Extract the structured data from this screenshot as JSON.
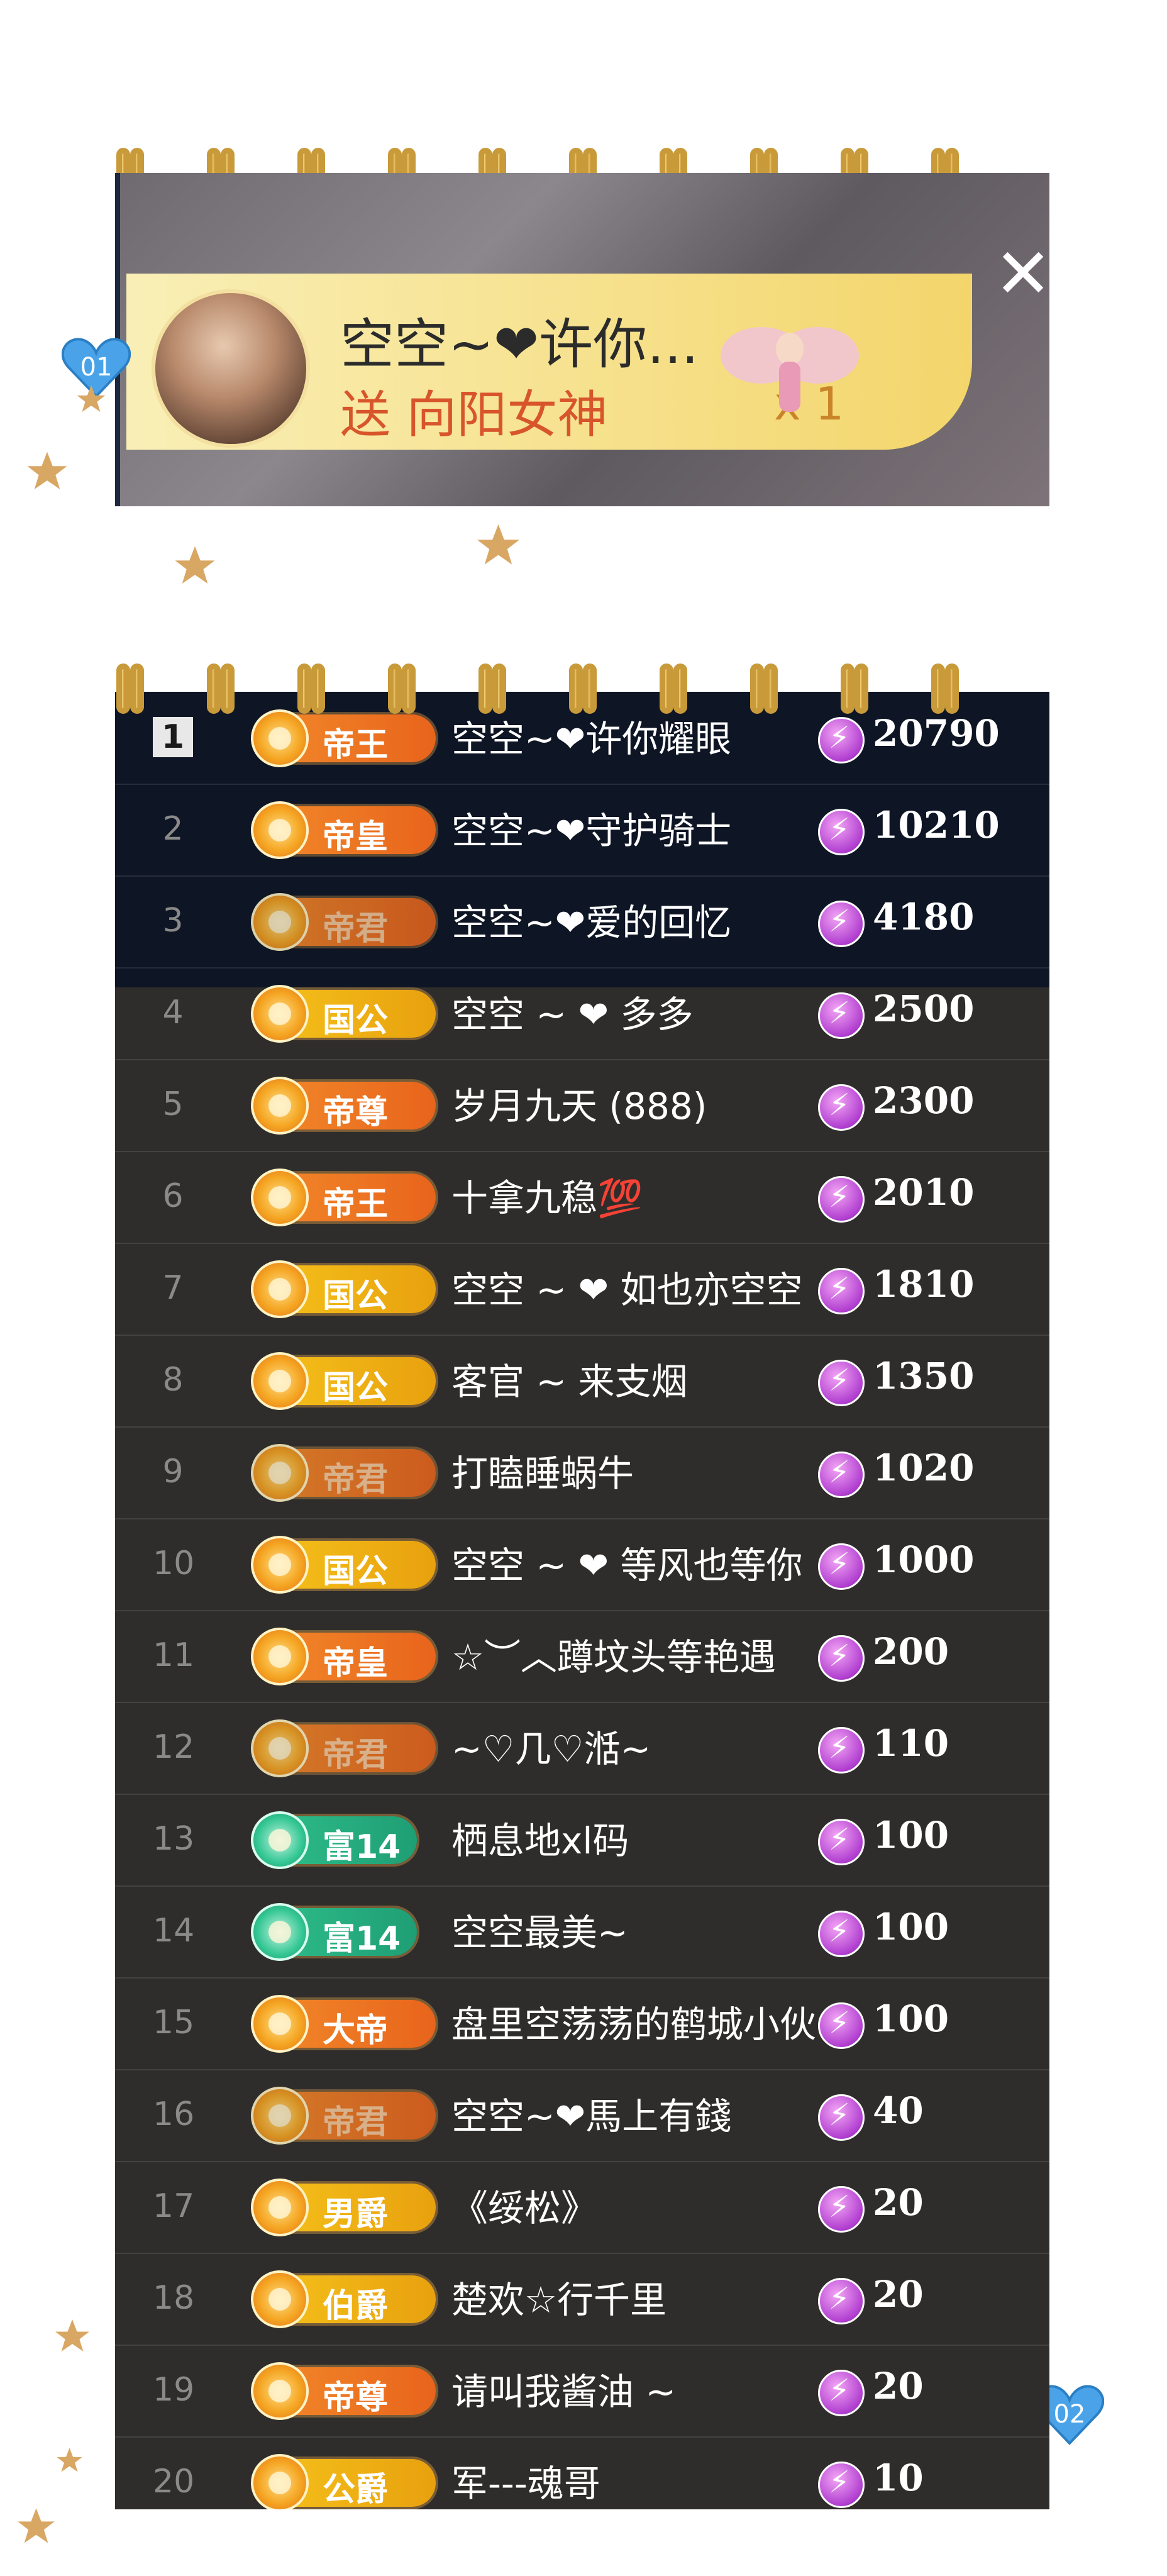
{
  "gift_card": {
    "sender": "空空~❤许你...",
    "gift_text": "送 向阳女神",
    "count": "x 1",
    "close": "✕"
  },
  "badges_numbers": {
    "heart_top": "01",
    "heart_bottom": "02"
  },
  "colors": {
    "ring": "#c89a3a",
    "rank_panel": "#2f2d2b",
    "gift_banner": "#f6e08a",
    "heart": "#4aa3e8",
    "coin": "#b13fd0"
  },
  "ranking": [
    {
      "rank": "1",
      "badge": "帝王",
      "style": "orange",
      "name": "空空~❤许你耀眼",
      "score": "20790"
    },
    {
      "rank": "2",
      "badge": "帝皇",
      "style": "orange",
      "name": "空空~❤守护骑士",
      "score": "10210"
    },
    {
      "rank": "3",
      "badge": "帝君",
      "style": "dim",
      "name": "空空~❤爱的回忆",
      "score": "4180"
    },
    {
      "rank": "4",
      "badge": "国公",
      "style": "gold",
      "name": "空空 ~ ❤ 多多",
      "score": "2500"
    },
    {
      "rank": "5",
      "badge": "帝尊",
      "style": "orange",
      "name": "岁月九天 (888)",
      "score": "2300"
    },
    {
      "rank": "6",
      "badge": "帝王",
      "style": "orange",
      "name": "十拿九稳💯",
      "score": "2010"
    },
    {
      "rank": "7",
      "badge": "国公",
      "style": "gold",
      "name": "空空 ~ ❤ 如也亦空空",
      "score": "1810"
    },
    {
      "rank": "8",
      "badge": "国公",
      "style": "gold",
      "name": "客官 ~ 来支烟",
      "score": "1350"
    },
    {
      "rank": "9",
      "badge": "帝君",
      "style": "dim",
      "name": "打瞌睡蜗牛",
      "score": "1020"
    },
    {
      "rank": "10",
      "badge": "国公",
      "style": "gold",
      "name": "空空 ~ ❤ 等风也等你",
      "score": "1000"
    },
    {
      "rank": "11",
      "badge": "帝皇",
      "style": "orange",
      "name": "☆︶︿蹲坟头等艳遇",
      "score": "200"
    },
    {
      "rank": "12",
      "badge": "帝君",
      "style": "dim",
      "name": "~♡几♡湉~",
      "score": "110"
    },
    {
      "rank": "13",
      "badge": "富14",
      "style": "green",
      "name": "栖息地xl码",
      "score": "100"
    },
    {
      "rank": "14",
      "badge": "富14",
      "style": "green",
      "name": "空空最美~",
      "score": "100"
    },
    {
      "rank": "15",
      "badge": "大帝",
      "style": "orange",
      "name": "盘里空荡荡的鹤城小伙",
      "score": "100"
    },
    {
      "rank": "16",
      "badge": "帝君",
      "style": "dim",
      "name": "空空~❤馬上有錢",
      "score": "40"
    },
    {
      "rank": "17",
      "badge": "男爵",
      "style": "gold",
      "name": "《绥松》",
      "score": "20"
    },
    {
      "rank": "18",
      "badge": "伯爵",
      "style": "gold",
      "name": "楚欢☆行千里",
      "score": "20"
    },
    {
      "rank": "19",
      "badge": "帝尊",
      "style": "orange",
      "name": "请叫我酱油 ~",
      "score": "20"
    },
    {
      "rank": "20",
      "badge": "公爵",
      "style": "gold",
      "name": "军---魂哥",
      "score": "10"
    }
  ]
}
